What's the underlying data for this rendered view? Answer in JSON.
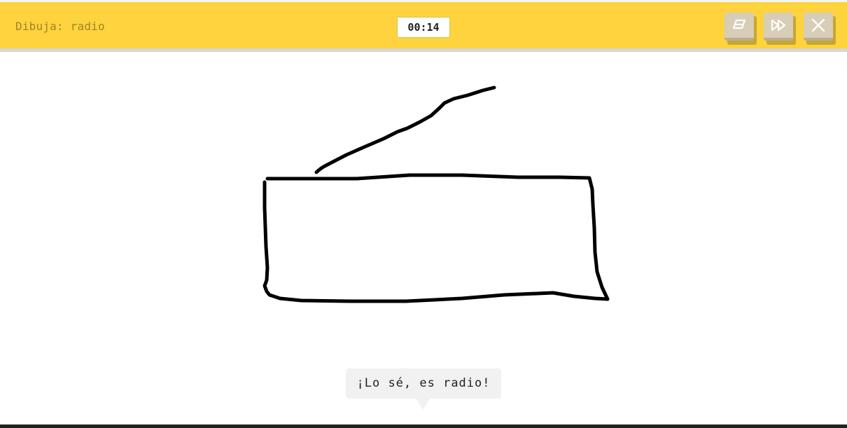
{
  "header": {
    "prompt_text": "Dibuja: radio",
    "timer": "00:14",
    "color": "#fed33d"
  },
  "toolbar": {
    "buttons": [
      {
        "name": "eraser-button",
        "icon": "eraser-icon"
      },
      {
        "name": "skip-button",
        "icon": "fast-forward-icon"
      },
      {
        "name": "close-button",
        "icon": "close-icon"
      }
    ]
  },
  "guess": {
    "text": "¡Lo sé, es radio!"
  }
}
